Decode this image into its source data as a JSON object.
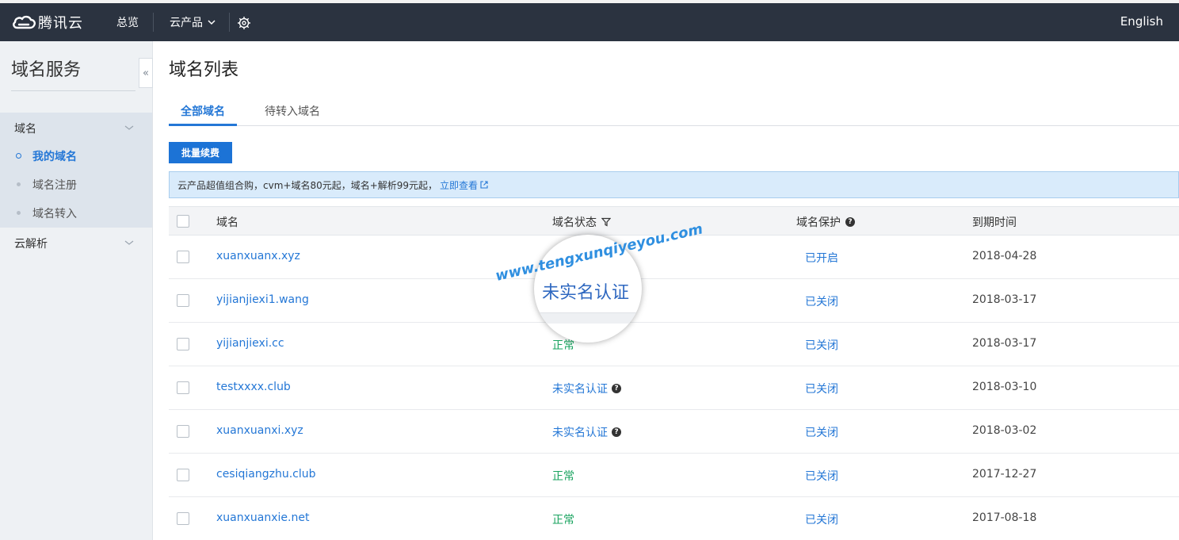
{
  "topbar": {
    "brand": "腾讯云",
    "overview": "总览",
    "products": "云产品",
    "language": "English"
  },
  "sidebar": {
    "title": "域名服务",
    "groups": [
      {
        "label": "域名",
        "items": [
          {
            "label": "我的域名",
            "active": true
          },
          {
            "label": "域名注册",
            "active": false
          },
          {
            "label": "域名转入",
            "active": false
          }
        ]
      },
      {
        "label": "云解析",
        "items": []
      }
    ]
  },
  "main": {
    "title": "域名列表",
    "tabs": [
      {
        "label": "全部域名",
        "active": true
      },
      {
        "label": "待转入域名",
        "active": false
      }
    ],
    "batch_button": "批量续费",
    "promo": {
      "text": "云产品超值组合购，cvm+域名80元起，域名+解析99元起，",
      "link": "立即查看"
    },
    "table": {
      "columns": [
        "域名",
        "域名状态",
        "域名保护",
        "到期时间"
      ],
      "rows": [
        {
          "domain": "xuanxuanx.xyz",
          "status": "",
          "protection": "已开启",
          "expire": "2018-04-28"
        },
        {
          "domain": "yijianjiexi1.wang",
          "status": "",
          "protection": "已关闭",
          "expire": "2018-03-17"
        },
        {
          "domain": "yijianjiexi.cc",
          "status": "正常",
          "protection": "已关闭",
          "expire": "2018-03-17"
        },
        {
          "domain": "testxxxx.club",
          "status": "未实名认证",
          "protection": "已关闭",
          "expire": "2018-03-10"
        },
        {
          "domain": "xuanxuanxi.xyz",
          "status": "未实名认证",
          "protection": "已关闭",
          "expire": "2018-03-02"
        },
        {
          "domain": "cesiqiangzhu.club",
          "status": "正常",
          "protection": "已关闭",
          "expire": "2017-12-27"
        },
        {
          "domain": "xuanxuanxie.net",
          "status": "正常",
          "protection": "已关闭",
          "expire": "2017-08-18"
        }
      ]
    }
  },
  "overlay": {
    "magnified_text": "未实名认证",
    "watermark": "www.tengxunqiyeyou.com"
  },
  "colors": {
    "topbar_bg": "#2b3340",
    "accent": "#2477d6",
    "status_ok": "#19a35f",
    "sidebar_bg": "#eef1f4"
  }
}
